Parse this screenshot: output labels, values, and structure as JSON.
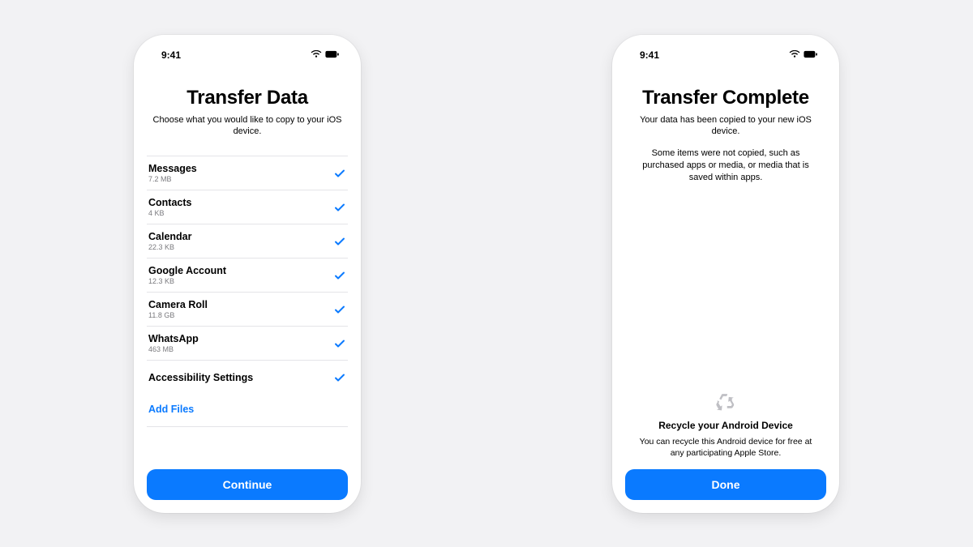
{
  "status": {
    "time": "9:41"
  },
  "left": {
    "title": "Transfer Data",
    "subtitle": "Choose what you would like to copy to your iOS device.",
    "items": [
      {
        "name": "Messages",
        "size": "7.2 MB"
      },
      {
        "name": "Contacts",
        "size": "4 KB"
      },
      {
        "name": "Calendar",
        "size": "22.3 KB"
      },
      {
        "name": "Google Account",
        "size": "12.3 KB"
      },
      {
        "name": "Camera Roll",
        "size": "11.8 GB"
      },
      {
        "name": "WhatsApp",
        "size": "463 MB"
      },
      {
        "name": "Accessibility Settings",
        "size": ""
      }
    ],
    "add_files_label": "Add Files",
    "continue_label": "Continue"
  },
  "right": {
    "title": "Transfer Complete",
    "subtitle1": "Your data has been copied to your new iOS device.",
    "subtitle2": "Some items were not copied, such as purchased apps or media, or media that is saved within apps.",
    "recycle_title": "Recycle your Android Device",
    "recycle_text": "You can recycle this Android device for free at any participating Apple Store.",
    "done_label": "Done"
  }
}
